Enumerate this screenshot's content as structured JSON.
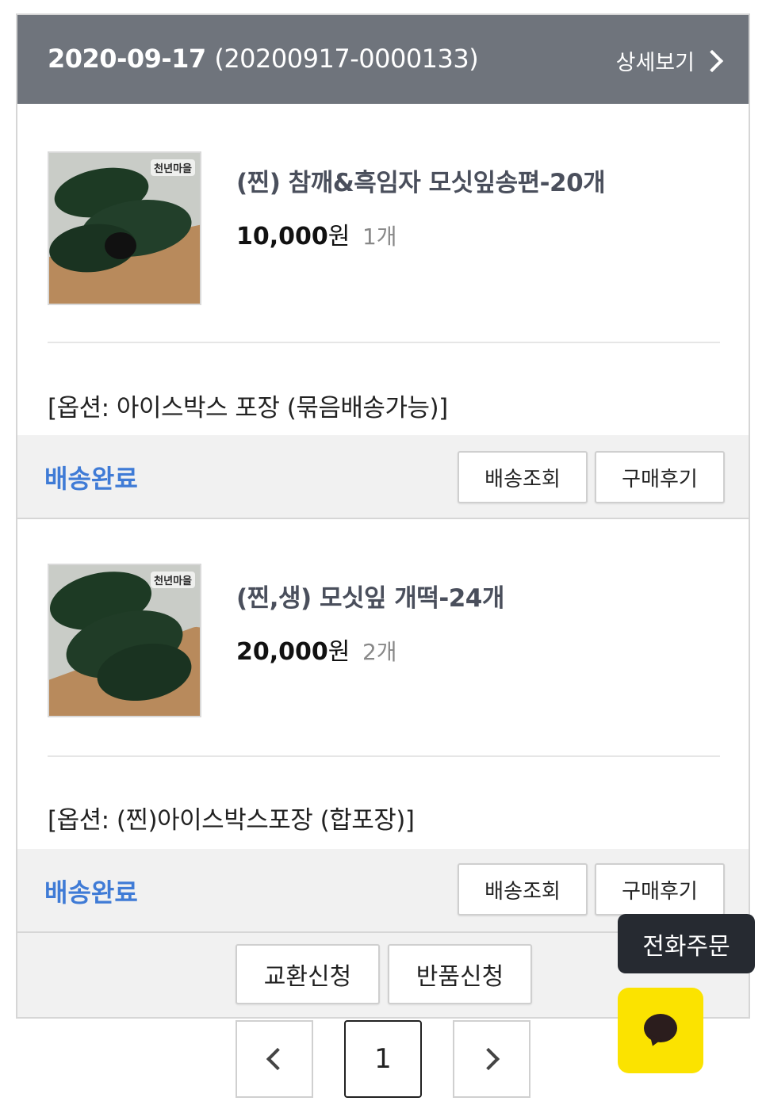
{
  "order": {
    "date": "2020-09-17",
    "order_number": "(20200917-0000133)",
    "detail_label": "상세보기"
  },
  "items": [
    {
      "name": "(찐) 참깨&흑임자 모싯잎송편-20개",
      "price": "10,000",
      "currency": "원",
      "quantity": "1개",
      "option": "[옵션: 아이스박스 포장 (묶음배송가능)]",
      "status": "배송완료",
      "track_label": "배송조회",
      "review_label": "구매후기",
      "thumb_logo": "천년마을"
    },
    {
      "name": "(찐,생) 모싯잎 개떡-24개",
      "price": "20,000",
      "currency": "원",
      "quantity": "2개",
      "option": "[옵션: (찐)아이스박스포장 (합포장)]",
      "status": "배송완료",
      "track_label": "배송조회",
      "review_label": "구매후기",
      "thumb_logo": "천년마을"
    }
  ],
  "actions": {
    "exchange_label": "교환신청",
    "return_label": "반품신청"
  },
  "pagination": {
    "current_page": "1"
  },
  "floating": {
    "phone_order_label": "전화주문",
    "kakao_icon": "kakao-chat-icon"
  },
  "colors": {
    "header_bg": "#6f747c",
    "status_blue": "#3f7bd6",
    "kakao_yellow": "#fbe300"
  }
}
